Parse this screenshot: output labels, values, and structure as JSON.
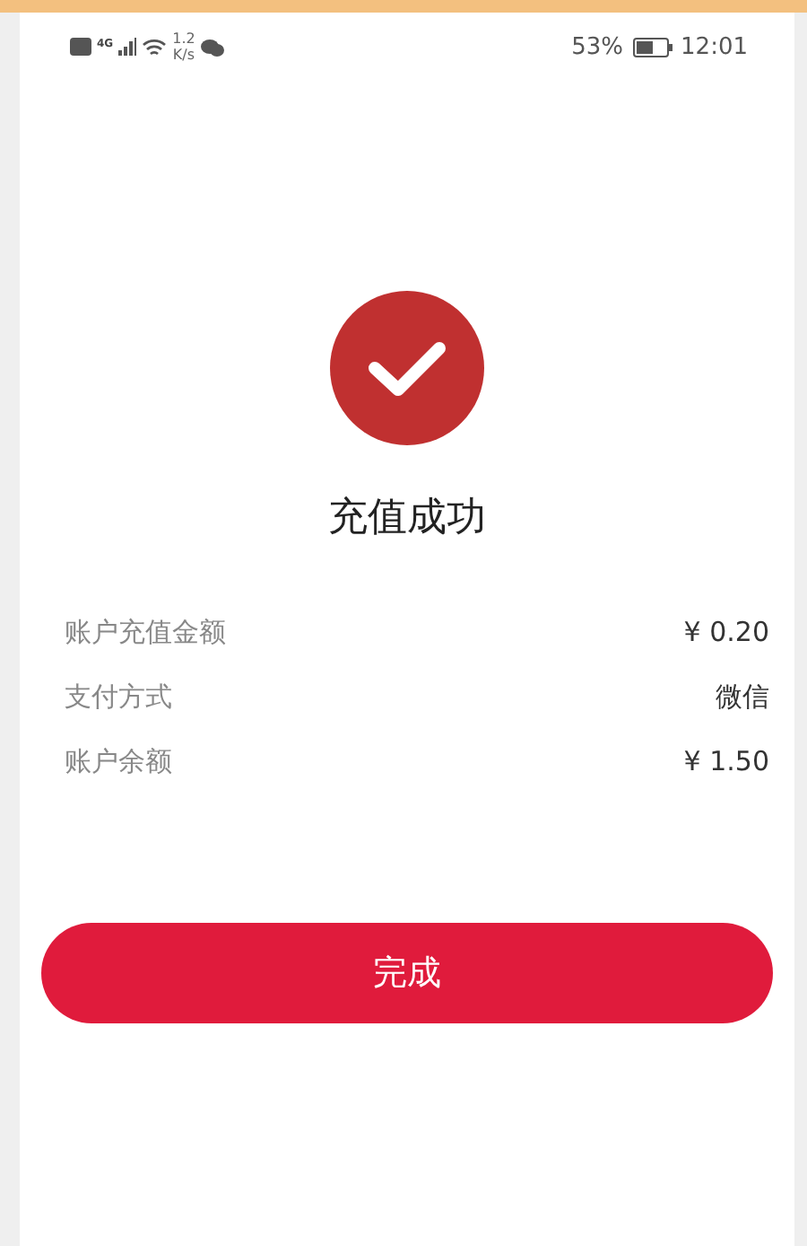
{
  "status_bar": {
    "speed_value": "1.2",
    "speed_unit": "K/s",
    "network": "4G",
    "battery_percent": "53%",
    "time": "12:01"
  },
  "result": {
    "title": "充值成功"
  },
  "details": [
    {
      "label": "账户充值金额",
      "value": "¥ 0.20"
    },
    {
      "label": "支付方式",
      "value": "微信"
    },
    {
      "label": "账户余额",
      "value": "¥ 1.50"
    }
  ],
  "done_button": {
    "label": "完成"
  }
}
